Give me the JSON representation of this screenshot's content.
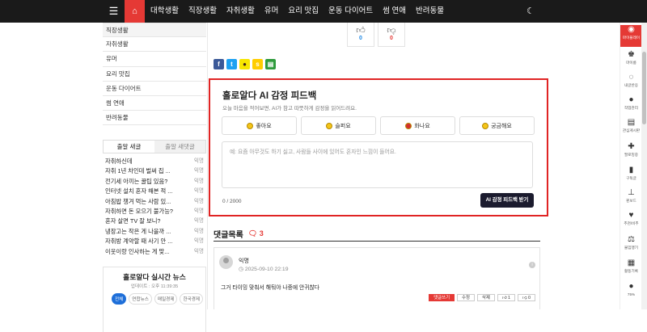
{
  "nav": {
    "menu_icon": "menu-icon",
    "home_icon": "home-icon",
    "items": [
      "대학생활",
      "직장생활",
      "자취생활",
      "유머",
      "요리 맛집",
      "운동 다이어트",
      "썸 연애",
      "반려동물"
    ],
    "dark_mode_icon": "moon-icon"
  },
  "sidebar": {
    "categories": [
      "직장생활",
      "자취생활",
      "유머",
      "요리 맛집",
      "운동 다이어트",
      "썸 연애",
      "반려동물"
    ],
    "tabs": [
      "출알 새글",
      "출알 새댓글"
    ],
    "posts": [
      {
        "title": "자취하신데",
        "author": "익명"
      },
      {
        "title": "자취 1년 차인데 벌써 집 ...",
        "author": "익명"
      },
      {
        "title": "전기세 아끼는 꿀팁 있음?",
        "author": "익명"
      },
      {
        "title": "인터넷 설치 혼자 해본 적 ...",
        "author": "익명"
      },
      {
        "title": "아침밥 챙겨 먹는 사람 있...",
        "author": "익명"
      },
      {
        "title": "자취하면 돈 모으기 불가능?",
        "author": "익명"
      },
      {
        "title": "혼자 살면 TV 잘 보니?",
        "author": "익명"
      },
      {
        "title": "냉장고는 작은 게 나을까 ...",
        "author": "익명"
      },
      {
        "title": "자취방 계약할 때 사기 안 ...",
        "author": "익명"
      },
      {
        "title": "이웃이랑 인사하는 게 맞...",
        "author": "익명"
      }
    ],
    "news": {
      "title": "홀로알다 실시간 뉴스",
      "updated": "업데이트 : 오후 11:39:35",
      "tabs": [
        "전체",
        "연합뉴스",
        "매일경제",
        "한국경제"
      ]
    }
  },
  "votes": [
    {
      "icon": "thumbs-up-icon",
      "count": "0",
      "color": "#1e88e5"
    },
    {
      "icon": "thumbs-down-icon",
      "count": "0",
      "color": "#e53935"
    }
  ],
  "share": [
    {
      "icon": "facebook-icon",
      "glyph": "f",
      "color": "#3b5998"
    },
    {
      "icon": "twitter-icon",
      "glyph": "t",
      "color": "#1da1f2"
    },
    {
      "icon": "kakaotalk-icon",
      "glyph": "●",
      "color": "#f7e600"
    },
    {
      "icon": "kakaostory-icon",
      "glyph": "s",
      "color": "#ffcd00"
    },
    {
      "icon": "band-icon",
      "glyph": "▤",
      "color": "#2f9b3c"
    }
  ],
  "ai": {
    "title": "홀로알다 AI 감정 피드백",
    "desc": "오늘 마음을 적어보면, AI가 참고 따뜻하게 감정을 읽어드려요.",
    "emotions": [
      {
        "label": "좋아요",
        "color": "#f5c518"
      },
      {
        "label": "슬퍼요",
        "color": "#f5c518"
      },
      {
        "label": "화나요",
        "color": "#d32f2f"
      },
      {
        "label": "궁금해요",
        "color": "#f5c518"
      }
    ],
    "placeholder": "예: 요즘 아무것도 하기 싫고, 사람들 사이에 있어도 혼자인 느낌이 들어요.",
    "count": "0 / 2000",
    "button": "AI 감정 피드백 받기"
  },
  "comments": {
    "title": "댓글목록",
    "count_icon": "comment-icon",
    "count": "3",
    "items": [
      {
        "author": "익명",
        "date": "2025-09-10 22:19",
        "text": "그거 타이밍 맞춰서 해둬야 나중에 안귀찮다",
        "actions": [
          "댓글쓰기",
          "수정",
          "삭제",
          "1",
          "0"
        ]
      }
    ]
  },
  "right_bar": [
    {
      "icon": "person-circle-icon",
      "glyph": "◉",
      "label": "마이플레이"
    },
    {
      "icon": "trophy-icon",
      "glyph": "♚",
      "label": "마이룸"
    },
    {
      "icon": "chat-bubble-icon",
      "glyph": "◌",
      "label": "내글반응"
    },
    {
      "icon": "person-icon",
      "glyph": "●",
      "label": "작업관리"
    },
    {
      "icon": "list-box-icon",
      "glyph": "▤",
      "label": "관심게시판"
    },
    {
      "icon": "person-plus-icon",
      "glyph": "✚",
      "label": "팔로잉중"
    },
    {
      "icon": "bell-icon",
      "glyph": "▮",
      "label": "구독글"
    },
    {
      "icon": "pin-icon",
      "glyph": "⊥",
      "label": "핀보드"
    },
    {
      "icon": "thumbs-up-icon",
      "glyph": "♥",
      "label": "추천/비추"
    },
    {
      "icon": "scale-icon",
      "glyph": "⚖",
      "label": "불임행기"
    },
    {
      "icon": "chart-icon",
      "glyph": "▦",
      "label": "활동기록"
    },
    {
      "icon": "avatar-icon",
      "glyph": "●",
      "label": "75%"
    }
  ]
}
